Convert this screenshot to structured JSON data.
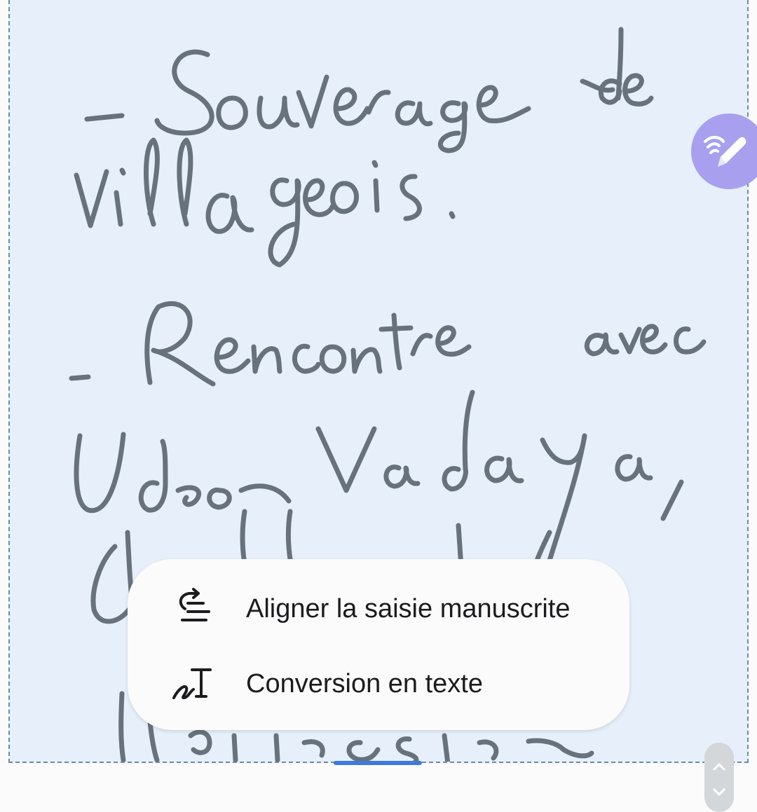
{
  "menu": {
    "items": [
      {
        "label": "Aligner la saisie manuscrite",
        "icon": "align-handwriting-icon"
      },
      {
        "label": "Conversion en texte",
        "icon": "convert-to-text-icon"
      }
    ]
  },
  "pen_button": {
    "icon": "pen-edit-icon"
  },
  "scroll_controls": {
    "up_icon": "chevron-up-icon",
    "down_icon": "chevron-down-icon"
  },
  "colors": {
    "canvas_bg": "#e7f0fa",
    "ink": "#68727c",
    "fab": "#a8a0ee",
    "accent": "#3e7bd6"
  }
}
